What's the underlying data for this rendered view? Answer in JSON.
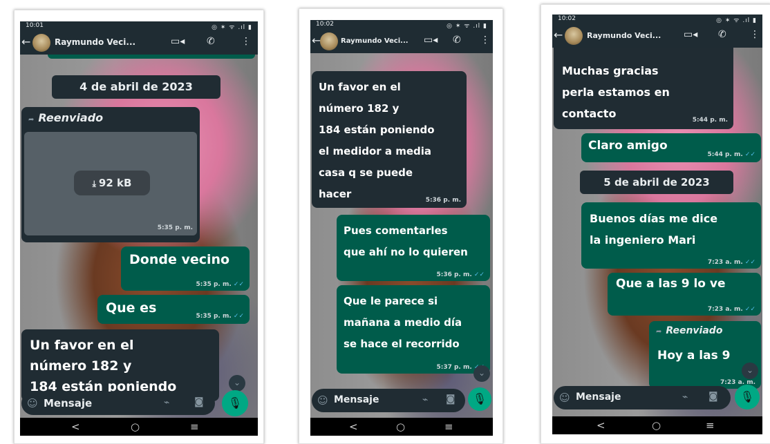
{
  "screens": [
    {
      "status_time": "10:01",
      "status_right": "◎ ✶ ᯤ .ıl ▮",
      "contact_name": "Raymundo Veci...",
      "date_chip": "4 de abril de 2023",
      "forwarded_label": "Reenviado",
      "file_size": "92 kB",
      "file_time": "5:35 p. m.",
      "messages": [
        {
          "text": "Donde vecino",
          "time": "5:35 p. m."
        },
        {
          "text": "Que es",
          "time": "5:35 p. m."
        },
        {
          "text": "Un favor en el\nnúmero 182 y\n184 están poniendo",
          "time": ""
        }
      ],
      "composer_placeholder": "Mensaje"
    },
    {
      "status_time": "10:02",
      "status_right": "◎ ✶ ᯤ .ıl ▮",
      "contact_name": "Raymundo Veci...",
      "messages": [
        {
          "text": "Un favor en el\nnúmero 182 y\n184 están poniendo\nel medidor a media\ncasa q se puede\nhacer",
          "time": "5:36 p. m."
        },
        {
          "text": "Pues comentarles\nque ahí no lo quieren",
          "time": "5:36 p. m."
        },
        {
          "text": "Que le parece si\nmañana a medio día\nse hace el recorrido",
          "time": "5:37 p. m."
        }
      ],
      "composer_placeholder": "Mensaje"
    },
    {
      "status_time": "10:02",
      "status_right": "◎ ✶ ᯤ .ıl ▮",
      "contact_name": "Raymundo Veci...",
      "date_chip": "5 de abril de 2023",
      "forwarded_label": "Reenviado",
      "messages": [
        {
          "text": "Muchas gracias\nperla estamos en\ncontacto",
          "time": "5:44 p. m."
        },
        {
          "text": "Claro amigo",
          "time": "5:44 p. m."
        },
        {
          "text": "Buenos días me dice\nla ingeniero Mari",
          "time": "7:23 a. m."
        },
        {
          "text": "Que a las 9 lo ve",
          "time": "7:23 a. m."
        },
        {
          "text": "Hoy a las 9",
          "time": "7:23 a. m."
        }
      ],
      "composer_placeholder": "Mensaje"
    }
  ],
  "icons": {
    "back": "←",
    "video": "▭◂",
    "phone": "✆",
    "menu": "⋮",
    "emoji": "☺",
    "clip": "⌁",
    "camera": "◙",
    "mic": "🎙",
    "nav_back": "<",
    "nav_home": "○",
    "nav_recent": "≡",
    "forward": "➦",
    "download": "⤓",
    "scroll_down": "⌄"
  },
  "colors": {
    "header_bg": "#1f2c33",
    "incoming_bubble": "#202c33",
    "outgoing_bubble": "#005c4b",
    "mic_button": "#00a884",
    "read_check": "#53bdeb"
  }
}
